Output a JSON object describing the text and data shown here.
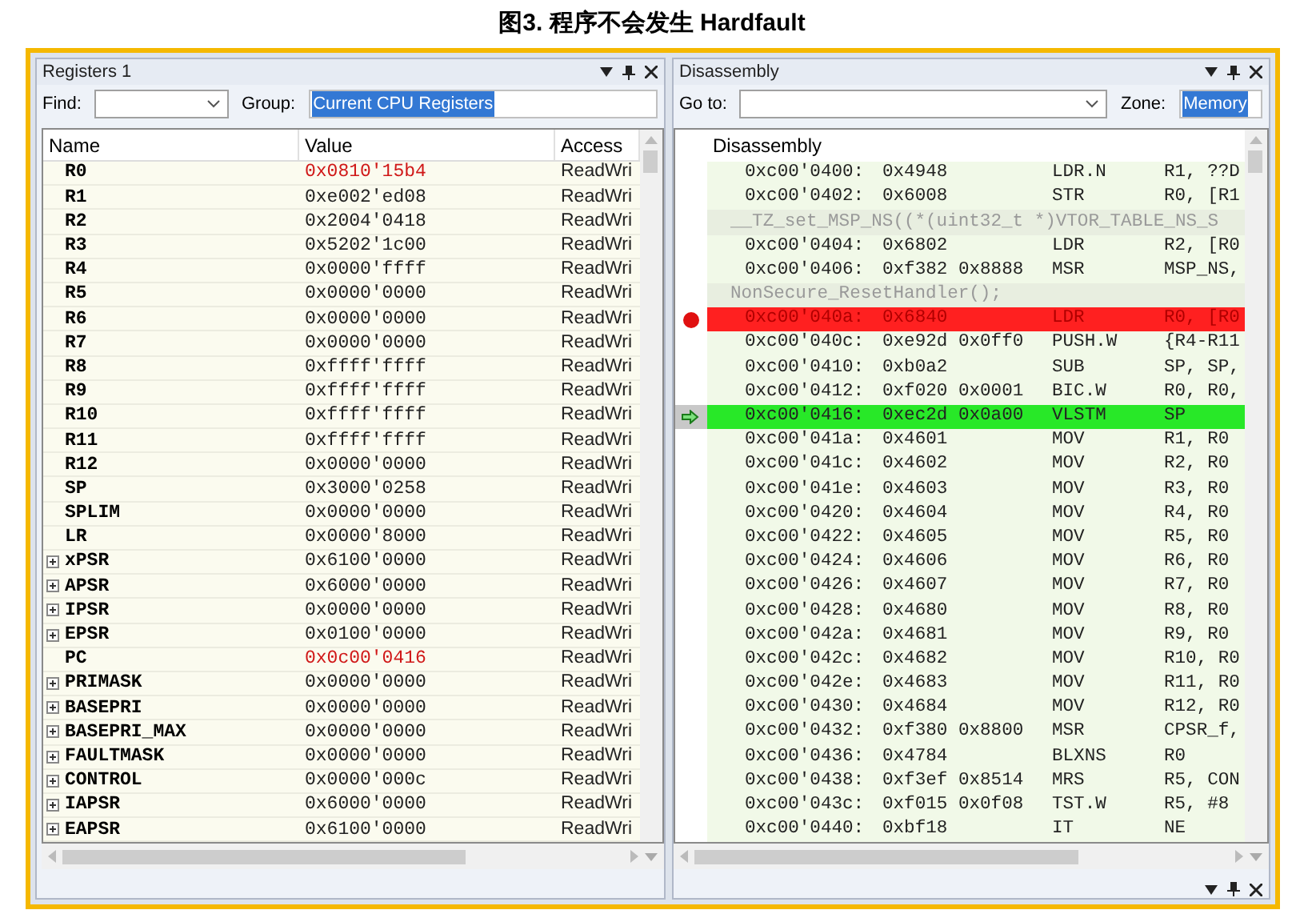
{
  "caption": "图3. 程序不会发生 Hardfault",
  "registers": {
    "title": "Registers 1",
    "find_label": "Find:",
    "group_label": "Group:",
    "group_value": "Current CPU Registers",
    "columns": [
      "Name",
      "Value",
      "Access"
    ],
    "rows": [
      {
        "name": "R0",
        "value": "0x0810'15b4",
        "access": "ReadWri",
        "changed": true,
        "expandable": false
      },
      {
        "name": "R1",
        "value": "0xe002'ed08",
        "access": "ReadWri",
        "changed": false,
        "expandable": false
      },
      {
        "name": "R2",
        "value": "0x2004'0418",
        "access": "ReadWri",
        "changed": false,
        "expandable": false
      },
      {
        "name": "R3",
        "value": "0x5202'1c00",
        "access": "ReadWri",
        "changed": false,
        "expandable": false
      },
      {
        "name": "R4",
        "value": "0x0000'ffff",
        "access": "ReadWri",
        "changed": false,
        "expandable": false
      },
      {
        "name": "R5",
        "value": "0x0000'0000",
        "access": "ReadWri",
        "changed": false,
        "expandable": false
      },
      {
        "name": "R6",
        "value": "0x0000'0000",
        "access": "ReadWri",
        "changed": false,
        "expandable": false
      },
      {
        "name": "R7",
        "value": "0x0000'0000",
        "access": "ReadWri",
        "changed": false,
        "expandable": false
      },
      {
        "name": "R8",
        "value": "0xffff'ffff",
        "access": "ReadWri",
        "changed": false,
        "expandable": false
      },
      {
        "name": "R9",
        "value": "0xffff'ffff",
        "access": "ReadWri",
        "changed": false,
        "expandable": false
      },
      {
        "name": "R10",
        "value": "0xffff'ffff",
        "access": "ReadWri",
        "changed": false,
        "expandable": false
      },
      {
        "name": "R11",
        "value": "0xffff'ffff",
        "access": "ReadWri",
        "changed": false,
        "expandable": false
      },
      {
        "name": "R12",
        "value": "0x0000'0000",
        "access": "ReadWri",
        "changed": false,
        "expandable": false
      },
      {
        "name": "SP",
        "value": "0x3000'0258",
        "access": "ReadWri",
        "changed": false,
        "expandable": false
      },
      {
        "name": "SPLIM",
        "value": "0x0000'0000",
        "access": "ReadWri",
        "changed": false,
        "expandable": false
      },
      {
        "name": "LR",
        "value": "0x0000'8000",
        "access": "ReadWri",
        "changed": false,
        "expandable": false
      },
      {
        "name": "xPSR",
        "value": "0x6100'0000",
        "access": "ReadWri",
        "changed": false,
        "expandable": true
      },
      {
        "name": "APSR",
        "value": "0x6000'0000",
        "access": "ReadWri",
        "changed": false,
        "expandable": true
      },
      {
        "name": "IPSR",
        "value": "0x0000'0000",
        "access": "ReadWri",
        "changed": false,
        "expandable": true
      },
      {
        "name": "EPSR",
        "value": "0x0100'0000",
        "access": "ReadWri",
        "changed": false,
        "expandable": true
      },
      {
        "name": "PC",
        "value": "0x0c00'0416",
        "access": "ReadWri",
        "changed": true,
        "expandable": false
      },
      {
        "name": "PRIMASK",
        "value": "0x0000'0000",
        "access": "ReadWri",
        "changed": false,
        "expandable": true
      },
      {
        "name": "BASEPRI",
        "value": "0x0000'0000",
        "access": "ReadWri",
        "changed": false,
        "expandable": true
      },
      {
        "name": "BASEPRI_MAX",
        "value": "0x0000'0000",
        "access": "ReadWri",
        "changed": false,
        "expandable": true
      },
      {
        "name": "FAULTMASK",
        "value": "0x0000'0000",
        "access": "ReadWri",
        "changed": false,
        "expandable": true
      },
      {
        "name": "CONTROL",
        "value": "0x0000'000c",
        "access": "ReadWri",
        "changed": false,
        "expandable": true
      },
      {
        "name": "IAPSR",
        "value": "0x6000'0000",
        "access": "ReadWri",
        "changed": false,
        "expandable": true
      },
      {
        "name": "EAPSR",
        "value": "0x6100'0000",
        "access": "ReadWri",
        "changed": false,
        "expandable": true
      }
    ]
  },
  "disassembly": {
    "title": "Disassembly",
    "goto_label": "Go to:",
    "zone_label": "Zone:",
    "zone_value": "Memory",
    "column": "Disassembly",
    "rows": [
      {
        "kind": "code",
        "address": "0xc00'0400:",
        "bytes": "0x4948",
        "mnemonic": "LDR.N",
        "operands": "R1, ??D",
        "breakpoint": false,
        "current": false
      },
      {
        "kind": "code",
        "address": "0xc00'0402:",
        "bytes": "0x6008",
        "mnemonic": "STR",
        "operands": "R0, [R1",
        "breakpoint": false,
        "current": false
      },
      {
        "kind": "source",
        "text": "__TZ_set_MSP_NS((*(uint32_t *)VTOR_TABLE_NS_S"
      },
      {
        "kind": "code",
        "address": "0xc00'0404:",
        "bytes": "0x6802",
        "mnemonic": "LDR",
        "operands": "R2, [R0",
        "breakpoint": false,
        "current": false
      },
      {
        "kind": "code",
        "address": "0xc00'0406:",
        "bytes": "0xf382 0x8888",
        "mnemonic": "MSR",
        "operands": "MSP_NS,",
        "breakpoint": false,
        "current": false
      },
      {
        "kind": "source",
        "text": "NonSecure_ResetHandler();"
      },
      {
        "kind": "code",
        "address": "0xc00'040a:",
        "bytes": "0x6840",
        "mnemonic": "LDR",
        "operands": "R0, [R0",
        "breakpoint": true,
        "current": false
      },
      {
        "kind": "code",
        "address": "0xc00'040c:",
        "bytes": "0xe92d 0x0ff0",
        "mnemonic": "PUSH.W",
        "operands": "{R4-R11",
        "breakpoint": false,
        "current": false
      },
      {
        "kind": "code",
        "address": "0xc00'0410:",
        "bytes": "0xb0a2",
        "mnemonic": "SUB",
        "operands": "SP, SP,",
        "breakpoint": false,
        "current": false
      },
      {
        "kind": "code",
        "address": "0xc00'0412:",
        "bytes": "0xf020 0x0001",
        "mnemonic": "BIC.W",
        "operands": "R0, R0,",
        "breakpoint": false,
        "current": false
      },
      {
        "kind": "code",
        "address": "0xc00'0416:",
        "bytes": "0xec2d 0x0a00",
        "mnemonic": "VLSTM",
        "operands": "SP",
        "breakpoint": false,
        "current": true
      },
      {
        "kind": "code",
        "address": "0xc00'041a:",
        "bytes": "0x4601",
        "mnemonic": "MOV",
        "operands": "R1, R0",
        "breakpoint": false,
        "current": false
      },
      {
        "kind": "code",
        "address": "0xc00'041c:",
        "bytes": "0x4602",
        "mnemonic": "MOV",
        "operands": "R2, R0",
        "breakpoint": false,
        "current": false
      },
      {
        "kind": "code",
        "address": "0xc00'041e:",
        "bytes": "0x4603",
        "mnemonic": "MOV",
        "operands": "R3, R0",
        "breakpoint": false,
        "current": false
      },
      {
        "kind": "code",
        "address": "0xc00'0420:",
        "bytes": "0x4604",
        "mnemonic": "MOV",
        "operands": "R4, R0",
        "breakpoint": false,
        "current": false
      },
      {
        "kind": "code",
        "address": "0xc00'0422:",
        "bytes": "0x4605",
        "mnemonic": "MOV",
        "operands": "R5, R0",
        "breakpoint": false,
        "current": false
      },
      {
        "kind": "code",
        "address": "0xc00'0424:",
        "bytes": "0x4606",
        "mnemonic": "MOV",
        "operands": "R6, R0",
        "breakpoint": false,
        "current": false
      },
      {
        "kind": "code",
        "address": "0xc00'0426:",
        "bytes": "0x4607",
        "mnemonic": "MOV",
        "operands": "R7, R0",
        "breakpoint": false,
        "current": false
      },
      {
        "kind": "code",
        "address": "0xc00'0428:",
        "bytes": "0x4680",
        "mnemonic": "MOV",
        "operands": "R8, R0",
        "breakpoint": false,
        "current": false
      },
      {
        "kind": "code",
        "address": "0xc00'042a:",
        "bytes": "0x4681",
        "mnemonic": "MOV",
        "operands": "R9, R0",
        "breakpoint": false,
        "current": false
      },
      {
        "kind": "code",
        "address": "0xc00'042c:",
        "bytes": "0x4682",
        "mnemonic": "MOV",
        "operands": "R10, R0",
        "breakpoint": false,
        "current": false
      },
      {
        "kind": "code",
        "address": "0xc00'042e:",
        "bytes": "0x4683",
        "mnemonic": "MOV",
        "operands": "R11, R0",
        "breakpoint": false,
        "current": false
      },
      {
        "kind": "code",
        "address": "0xc00'0430:",
        "bytes": "0x4684",
        "mnemonic": "MOV",
        "operands": "R12, R0",
        "breakpoint": false,
        "current": false
      },
      {
        "kind": "code",
        "address": "0xc00'0432:",
        "bytes": "0xf380 0x8800",
        "mnemonic": "MSR",
        "operands": "CPSR_f,",
        "breakpoint": false,
        "current": false
      },
      {
        "kind": "code",
        "address": "0xc00'0436:",
        "bytes": "0x4784",
        "mnemonic": "BLXNS",
        "operands": "R0",
        "breakpoint": false,
        "current": false
      },
      {
        "kind": "code",
        "address": "0xc00'0438:",
        "bytes": "0xf3ef 0x8514",
        "mnemonic": "MRS",
        "operands": "R5, CON",
        "breakpoint": false,
        "current": false
      },
      {
        "kind": "code",
        "address": "0xc00'043c:",
        "bytes": "0xf015 0x0f08",
        "mnemonic": "TST.W",
        "operands": "R5, #8",
        "breakpoint": false,
        "current": false
      },
      {
        "kind": "code",
        "address": "0xc00'0440:",
        "bytes": "0xbf18",
        "mnemonic": "IT",
        "operands": "NE",
        "breakpoint": false,
        "current": false
      }
    ]
  }
}
